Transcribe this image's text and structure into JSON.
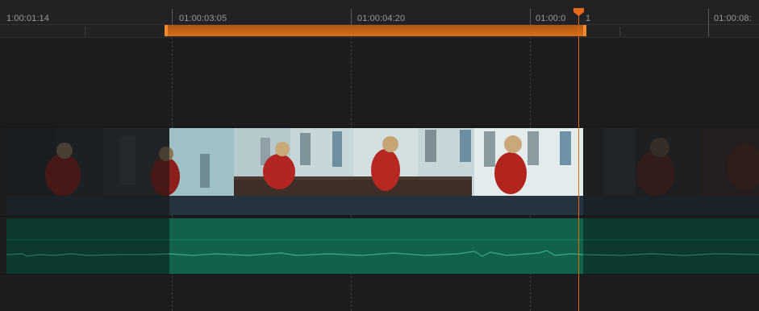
{
  "ruler": {
    "timecodes": [
      "1:00:01:14",
      "01:00:03:05",
      "01:00:04:20",
      "01:00:0",
      "1",
      "01:00:08:"
    ]
  },
  "colors": {
    "playhead": "#e4661c",
    "inout_range": "#d6701c",
    "video_bar": "#25343e",
    "audio_clip": "#10624b"
  },
  "icons": {
    "playhead_marker": "playhead-icon"
  }
}
